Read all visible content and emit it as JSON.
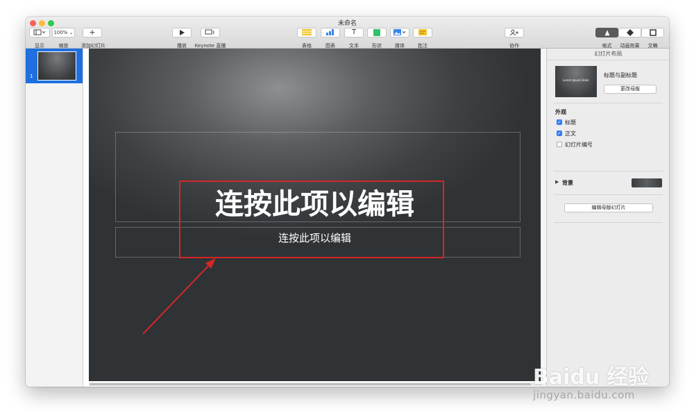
{
  "window": {
    "title": "未命名"
  },
  "toolbar": {
    "view": {
      "label": "显示"
    },
    "zoom": {
      "value": "100%",
      "label": "缩放"
    },
    "add_slide": {
      "label": "添加幻灯片"
    },
    "play": {
      "label": "播放"
    },
    "keynote_live": {
      "label": "Keynote 直播"
    },
    "table": {
      "label": "表格"
    },
    "chart": {
      "label": "图表"
    },
    "text": {
      "label": "文本"
    },
    "shape": {
      "label": "形状"
    },
    "media": {
      "label": "媒体"
    },
    "comment": {
      "label": "批注"
    },
    "collaborate": {
      "label": "协作"
    },
    "format": {
      "label": "格式"
    },
    "animate": {
      "label": "动画效果"
    },
    "document": {
      "label": "文稿"
    }
  },
  "navigator": {
    "slides": [
      {
        "number": "1"
      }
    ]
  },
  "slide": {
    "title": "连按此项以编辑",
    "body": "连按此项以编辑"
  },
  "inspector": {
    "header": "幻灯片布局",
    "master_thumb_text": "Lorem Ipsum Dolor",
    "master_name": "标题与副标题",
    "change_master": "更改母版",
    "appearance": {
      "label": "外观",
      "title": {
        "label": "标题",
        "checked": true
      },
      "body": {
        "label": "正文",
        "checked": true
      },
      "slide_number": {
        "label": "幻灯片编号",
        "checked": false
      }
    },
    "background": {
      "label": "背景"
    },
    "edit_master": "编辑母版幻灯片"
  },
  "colors": {
    "selection": "#1f6fe0",
    "annotation": "#d42727",
    "checkbox": "#2f7bf5"
  },
  "watermark": {
    "logo": "Baidu 经验",
    "url": "jingyan.baidu.com"
  }
}
